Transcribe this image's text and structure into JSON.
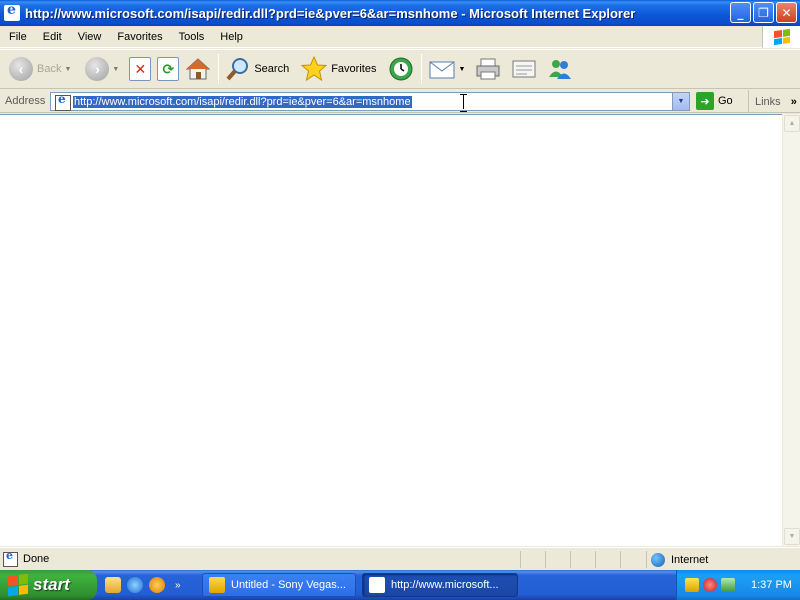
{
  "window": {
    "title": "http://www.microsoft.com/isapi/redir.dll?prd=ie&pver=6&ar=msnhome - Microsoft Internet Explorer",
    "controls": {
      "minimize": "_",
      "maximize": "❐",
      "close": "✕"
    }
  },
  "menu": [
    "File",
    "Edit",
    "View",
    "Favorites",
    "Tools",
    "Help"
  ],
  "toolbar": {
    "back_label": "Back",
    "search_label": "Search",
    "favorites_label": "Favorites"
  },
  "address": {
    "label": "Address",
    "url": "http://www.microsoft.com/isapi/redir.dll?prd=ie&pver=6&ar=msnhome",
    "go_label": "Go",
    "links_label": "Links",
    "links_chevron": "»"
  },
  "status": {
    "text": "Done",
    "zone": "Internet"
  },
  "taskbar": {
    "start_label": "start",
    "quicklaunch_more": "»",
    "tasks": [
      {
        "label": "Untitled - Sony Vegas...",
        "active": false
      },
      {
        "label": "http://www.microsoft...",
        "active": true
      }
    ],
    "clock": "1:37 PM"
  },
  "colors": {
    "titlebar": "#0a55d6",
    "selection": "#316ac5",
    "start_button": "#3fb13f",
    "taskbar": "#245ed4",
    "tray": "#1788e6"
  },
  "icons": {
    "back": "back-arrow-icon",
    "forward": "forward-arrow-icon",
    "stop": "stop-icon",
    "refresh": "refresh-icon",
    "home": "home-icon",
    "search": "magnifier-icon",
    "favorites": "star-icon",
    "history": "history-icon",
    "mail": "mail-icon",
    "print": "printer-icon",
    "edit": "edit-icon",
    "messenger": "messenger-icon"
  }
}
